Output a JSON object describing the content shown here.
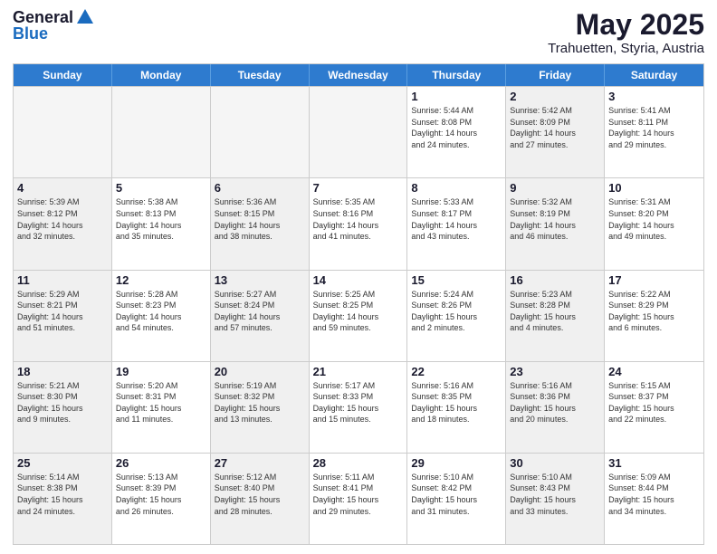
{
  "header": {
    "logo_line1": "General",
    "logo_line2": "Blue",
    "month_year": "May 2025",
    "location": "Trahuetten, Styria, Austria"
  },
  "weekdays": [
    "Sunday",
    "Monday",
    "Tuesday",
    "Wednesday",
    "Thursday",
    "Friday",
    "Saturday"
  ],
  "rows": [
    [
      {
        "day": "",
        "detail": "",
        "empty": true
      },
      {
        "day": "",
        "detail": "",
        "empty": true
      },
      {
        "day": "",
        "detail": "",
        "empty": true
      },
      {
        "day": "",
        "detail": "",
        "empty": true
      },
      {
        "day": "1",
        "detail": "Sunrise: 5:44 AM\nSunset: 8:08 PM\nDaylight: 14 hours\nand 24 minutes.",
        "empty": false
      },
      {
        "day": "2",
        "detail": "Sunrise: 5:42 AM\nSunset: 8:09 PM\nDaylight: 14 hours\nand 27 minutes.",
        "empty": false,
        "shaded": true
      },
      {
        "day": "3",
        "detail": "Sunrise: 5:41 AM\nSunset: 8:11 PM\nDaylight: 14 hours\nand 29 minutes.",
        "empty": false
      }
    ],
    [
      {
        "day": "4",
        "detail": "Sunrise: 5:39 AM\nSunset: 8:12 PM\nDaylight: 14 hours\nand 32 minutes.",
        "empty": false,
        "shaded": true
      },
      {
        "day": "5",
        "detail": "Sunrise: 5:38 AM\nSunset: 8:13 PM\nDaylight: 14 hours\nand 35 minutes.",
        "empty": false
      },
      {
        "day": "6",
        "detail": "Sunrise: 5:36 AM\nSunset: 8:15 PM\nDaylight: 14 hours\nand 38 minutes.",
        "empty": false,
        "shaded": true
      },
      {
        "day": "7",
        "detail": "Sunrise: 5:35 AM\nSunset: 8:16 PM\nDaylight: 14 hours\nand 41 minutes.",
        "empty": false
      },
      {
        "day": "8",
        "detail": "Sunrise: 5:33 AM\nSunset: 8:17 PM\nDaylight: 14 hours\nand 43 minutes.",
        "empty": false
      },
      {
        "day": "9",
        "detail": "Sunrise: 5:32 AM\nSunset: 8:19 PM\nDaylight: 14 hours\nand 46 minutes.",
        "empty": false,
        "shaded": true
      },
      {
        "day": "10",
        "detail": "Sunrise: 5:31 AM\nSunset: 8:20 PM\nDaylight: 14 hours\nand 49 minutes.",
        "empty": false
      }
    ],
    [
      {
        "day": "11",
        "detail": "Sunrise: 5:29 AM\nSunset: 8:21 PM\nDaylight: 14 hours\nand 51 minutes.",
        "empty": false,
        "shaded": true
      },
      {
        "day": "12",
        "detail": "Sunrise: 5:28 AM\nSunset: 8:23 PM\nDaylight: 14 hours\nand 54 minutes.",
        "empty": false
      },
      {
        "day": "13",
        "detail": "Sunrise: 5:27 AM\nSunset: 8:24 PM\nDaylight: 14 hours\nand 57 minutes.",
        "empty": false,
        "shaded": true
      },
      {
        "day": "14",
        "detail": "Sunrise: 5:25 AM\nSunset: 8:25 PM\nDaylight: 14 hours\nand 59 minutes.",
        "empty": false
      },
      {
        "day": "15",
        "detail": "Sunrise: 5:24 AM\nSunset: 8:26 PM\nDaylight: 15 hours\nand 2 minutes.",
        "empty": false
      },
      {
        "day": "16",
        "detail": "Sunrise: 5:23 AM\nSunset: 8:28 PM\nDaylight: 15 hours\nand 4 minutes.",
        "empty": false,
        "shaded": true
      },
      {
        "day": "17",
        "detail": "Sunrise: 5:22 AM\nSunset: 8:29 PM\nDaylight: 15 hours\nand 6 minutes.",
        "empty": false
      }
    ],
    [
      {
        "day": "18",
        "detail": "Sunrise: 5:21 AM\nSunset: 8:30 PM\nDaylight: 15 hours\nand 9 minutes.",
        "empty": false,
        "shaded": true
      },
      {
        "day": "19",
        "detail": "Sunrise: 5:20 AM\nSunset: 8:31 PM\nDaylight: 15 hours\nand 11 minutes.",
        "empty": false
      },
      {
        "day": "20",
        "detail": "Sunrise: 5:19 AM\nSunset: 8:32 PM\nDaylight: 15 hours\nand 13 minutes.",
        "empty": false,
        "shaded": true
      },
      {
        "day": "21",
        "detail": "Sunrise: 5:17 AM\nSunset: 8:33 PM\nDaylight: 15 hours\nand 15 minutes.",
        "empty": false
      },
      {
        "day": "22",
        "detail": "Sunrise: 5:16 AM\nSunset: 8:35 PM\nDaylight: 15 hours\nand 18 minutes.",
        "empty": false
      },
      {
        "day": "23",
        "detail": "Sunrise: 5:16 AM\nSunset: 8:36 PM\nDaylight: 15 hours\nand 20 minutes.",
        "empty": false,
        "shaded": true
      },
      {
        "day": "24",
        "detail": "Sunrise: 5:15 AM\nSunset: 8:37 PM\nDaylight: 15 hours\nand 22 minutes.",
        "empty": false
      }
    ],
    [
      {
        "day": "25",
        "detail": "Sunrise: 5:14 AM\nSunset: 8:38 PM\nDaylight: 15 hours\nand 24 minutes.",
        "empty": false,
        "shaded": true
      },
      {
        "day": "26",
        "detail": "Sunrise: 5:13 AM\nSunset: 8:39 PM\nDaylight: 15 hours\nand 26 minutes.",
        "empty": false
      },
      {
        "day": "27",
        "detail": "Sunrise: 5:12 AM\nSunset: 8:40 PM\nDaylight: 15 hours\nand 28 minutes.",
        "empty": false,
        "shaded": true
      },
      {
        "day": "28",
        "detail": "Sunrise: 5:11 AM\nSunset: 8:41 PM\nDaylight: 15 hours\nand 29 minutes.",
        "empty": false
      },
      {
        "day": "29",
        "detail": "Sunrise: 5:10 AM\nSunset: 8:42 PM\nDaylight: 15 hours\nand 31 minutes.",
        "empty": false
      },
      {
        "day": "30",
        "detail": "Sunrise: 5:10 AM\nSunset: 8:43 PM\nDaylight: 15 hours\nand 33 minutes.",
        "empty": false,
        "shaded": true
      },
      {
        "day": "31",
        "detail": "Sunrise: 5:09 AM\nSunset: 8:44 PM\nDaylight: 15 hours\nand 34 minutes.",
        "empty": false
      }
    ]
  ]
}
